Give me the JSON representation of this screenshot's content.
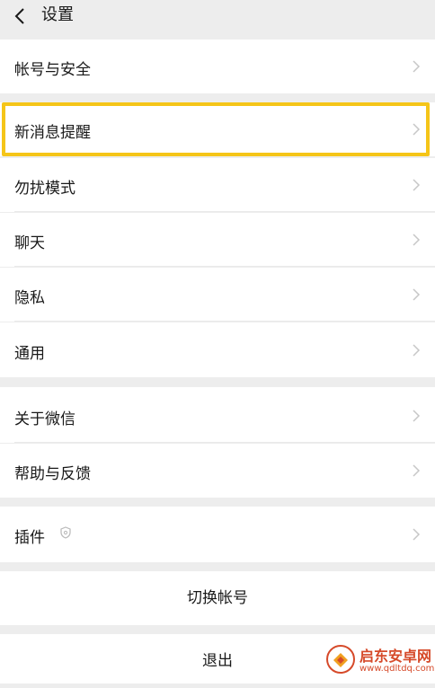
{
  "header": {
    "title": "设置"
  },
  "group1": {
    "items": [
      {
        "label": "帐号与安全"
      }
    ]
  },
  "group2": {
    "items": [
      {
        "label": "新消息提醒"
      },
      {
        "label": "勿扰模式"
      },
      {
        "label": "聊天"
      },
      {
        "label": "隐私"
      },
      {
        "label": "通用"
      }
    ]
  },
  "group3": {
    "items": [
      {
        "label": "关于微信"
      },
      {
        "label": "帮助与反馈"
      }
    ]
  },
  "group4": {
    "items": [
      {
        "label": "插件"
      }
    ]
  },
  "actions": {
    "switch_account": "切换帐号",
    "logout": "退出"
  },
  "watermark": {
    "name": "启东安卓网",
    "url": "www.qdltdq.com"
  },
  "colors": {
    "highlight": "#f5c518",
    "background": "#ededed",
    "watermark": "#d64a2a"
  }
}
